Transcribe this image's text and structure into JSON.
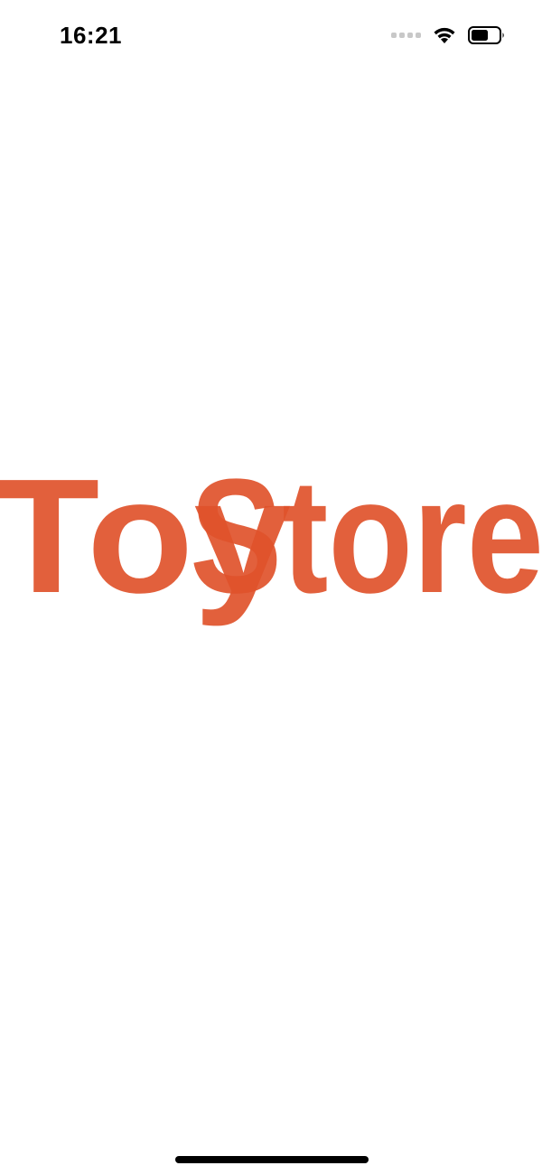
{
  "status_bar": {
    "time": "16:21",
    "icons": [
      "signal-icon",
      "wifi-icon",
      "battery-icon"
    ]
  },
  "splash": {
    "logo_text_part1": "Toy",
    "logo_text_part2": "Store",
    "logo_color": "#E0532B",
    "logo_overlap_color": "#D43C25"
  },
  "colors": {
    "background": "#FFFFFF",
    "status_text": "#000000",
    "home_indicator": "#000000"
  }
}
